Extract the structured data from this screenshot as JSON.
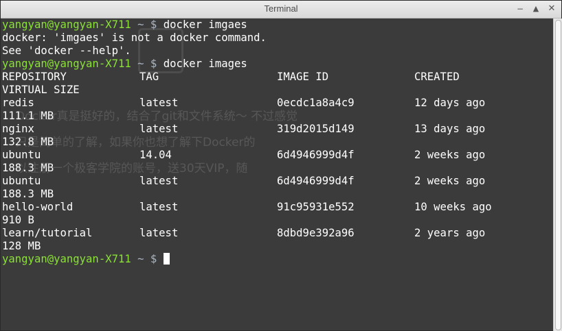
{
  "window": {
    "title": "Terminal",
    "minimize_glyph": "−",
    "maximize_glyph": "▲",
    "close_glyph": "✕"
  },
  "terminal": {
    "prompt": "yangyan@yangyan-X711",
    "prompt_path": " ~ $ ",
    "cmd1": "docker imgaes",
    "error1": "docker: 'imgaes' is not a docker command.",
    "error2": "See 'docker --help'.",
    "cmd2": "docker images",
    "headers": [
      "REPOSITORY",
      "TAG",
      "IMAGE ID",
      "CREATED"
    ],
    "header_size": "VIRTUAL SIZE",
    "rows": [
      {
        "repo": "redis",
        "tag": "latest",
        "id": "0ecdc1a8a4c9",
        "created": "12 days ago",
        "size": "111.1 MB"
      },
      {
        "repo": "nginx",
        "tag": "latest",
        "id": "319d2015d149",
        "created": "13 days ago",
        "size": "132.8 MB"
      },
      {
        "repo": "ubuntu",
        "tag": "14.04",
        "id": "6d4946999d4f",
        "created": "2 weeks ago",
        "size": "188.3 MB"
      },
      {
        "repo": "ubuntu",
        "tag": "latest",
        "id": "6d4946999d4f",
        "created": "2 weeks ago",
        "size": "188.3 MB"
      },
      {
        "repo": "hello-world",
        "tag": "latest",
        "id": "91c95931e552",
        "created": "10 weeks ago",
        "size": "910 B"
      },
      {
        "repo": "learn/tutorial",
        "tag": "latest",
        "id": "8dbd9e392a96",
        "created": "2 years ago",
        "size": "128 MB"
      }
    ]
  },
  "watermark": {
    "line1": "Docker真是挺好的，结合了git和文件系统～ 不过感觉",
    "line2": "只是简单的了解，如果你也想了解下Docker的",
    "line3": "以注册一个极客学院的账号，送30天VIP，随"
  },
  "colors": {
    "prompt": "#8ae234",
    "background": "#3b3b3b",
    "text": "#ffffff"
  }
}
